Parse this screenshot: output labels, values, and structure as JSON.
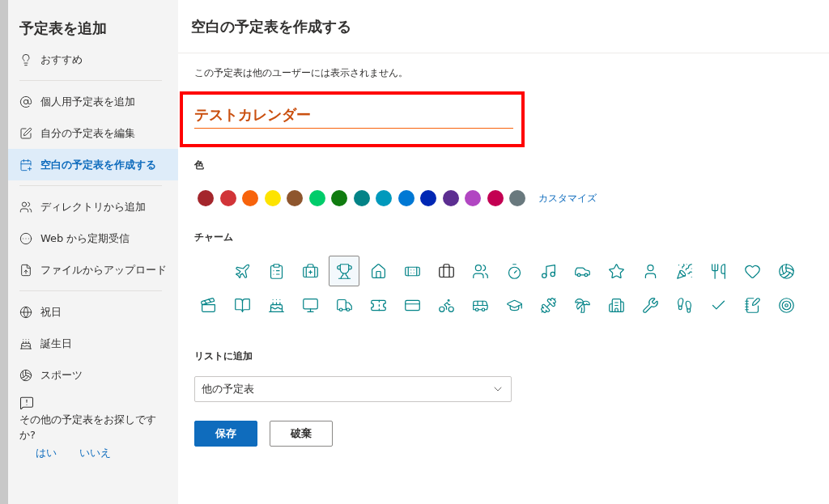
{
  "sidebar": {
    "title": "予定表を追加",
    "groups": [
      [
        {
          "kind": "bulb",
          "label": "おすすめ",
          "selected": false
        }
      ],
      [
        {
          "kind": "at",
          "label": "個人用予定表を追加",
          "selected": false
        },
        {
          "kind": "edit",
          "label": "自分の予定表を編集",
          "selected": false
        },
        {
          "kind": "calendar",
          "label": "空白の予定表を作成する",
          "selected": true
        }
      ],
      [
        {
          "kind": "people",
          "label": "ディレクトリから追加",
          "selected": false
        },
        {
          "kind": "ellipsis",
          "label": "Web から定期受信",
          "selected": false
        },
        {
          "kind": "file",
          "label": "ファイルからアップロード",
          "selected": false
        }
      ],
      [
        {
          "kind": "globe",
          "label": "祝日",
          "selected": false
        },
        {
          "kind": "cake",
          "label": "誕生日",
          "selected": false
        },
        {
          "kind": "ball",
          "label": "スポーツ",
          "selected": false
        }
      ]
    ],
    "feedback": {
      "question": "その他の予定表をお探しですか?",
      "answers": [
        "はい",
        "いいえ"
      ]
    }
  },
  "main": {
    "title": "空白の予定表を作成する",
    "note": "この予定表は他のユーザーには表示されません。",
    "name_field": {
      "value": "テストカレンダー"
    },
    "color_label": "色",
    "colors": [
      {
        "color": "#a4262c"
      },
      {
        "color": "#d13438"
      },
      {
        "color": "#f7630c"
      },
      {
        "color": "#fde300"
      },
      {
        "color": "#8e562e"
      },
      {
        "color": "#00cc6a"
      },
      {
        "color": "#107c10"
      },
      {
        "color": "#038387"
      },
      {
        "color": "#0099bc"
      },
      {
        "color": "#0078d4"
      },
      {
        "color": "#0027b4"
      },
      {
        "color": "#5c2e91"
      },
      {
        "color": "#b146c2"
      },
      {
        "color": "#c30052"
      },
      {
        "color": "#69797e"
      }
    ],
    "customize_link": "カスタマイズ",
    "charm_label": "チャーム",
    "charm_rows": [
      [
        {
          "kind": "plane",
          "selected": false
        },
        {
          "kind": "clipboard",
          "selected": false
        },
        {
          "kind": "medkit",
          "selected": false
        },
        {
          "kind": "trophy",
          "selected": true
        },
        {
          "kind": "house",
          "selected": false
        },
        {
          "kind": "bandage",
          "selected": false
        },
        {
          "kind": "briefcase",
          "selected": false
        },
        {
          "kind": "people",
          "selected": false
        },
        {
          "kind": "timer",
          "selected": false
        },
        {
          "kind": "music",
          "selected": false
        },
        {
          "kind": "car",
          "selected": false
        },
        {
          "kind": "star",
          "selected": false
        },
        {
          "kind": "person",
          "selected": false
        },
        {
          "kind": "party",
          "selected": false
        },
        {
          "kind": "utensils",
          "selected": false
        },
        {
          "kind": "heart",
          "selected": false
        },
        {
          "kind": "ball",
          "selected": false
        }
      ],
      [
        {
          "kind": "clapper",
          "selected": false
        },
        {
          "kind": "book",
          "selected": false
        },
        {
          "kind": "cake",
          "selected": false
        },
        {
          "kind": "monitor",
          "selected": false
        },
        {
          "kind": "truck",
          "selected": false
        },
        {
          "kind": "ticket",
          "selected": false
        },
        {
          "kind": "card",
          "selected": false
        },
        {
          "kind": "bike",
          "selected": false
        },
        {
          "kind": "bus",
          "selected": false
        },
        {
          "kind": "cap",
          "selected": false
        },
        {
          "kind": "dumbbell",
          "selected": false
        },
        {
          "kind": "palm",
          "selected": false
        },
        {
          "kind": "building",
          "selected": false
        },
        {
          "kind": "wrench",
          "selected": false
        },
        {
          "kind": "shoe",
          "selected": false
        },
        {
          "kind": "check",
          "selected": false
        },
        {
          "kind": "notebook",
          "selected": false
        },
        {
          "kind": "target",
          "selected": false
        }
      ]
    ],
    "list_label": "リストに追加",
    "list_dropdown": {
      "value": "他の予定表"
    },
    "save_button": "保存",
    "discard_button": "破棄"
  }
}
